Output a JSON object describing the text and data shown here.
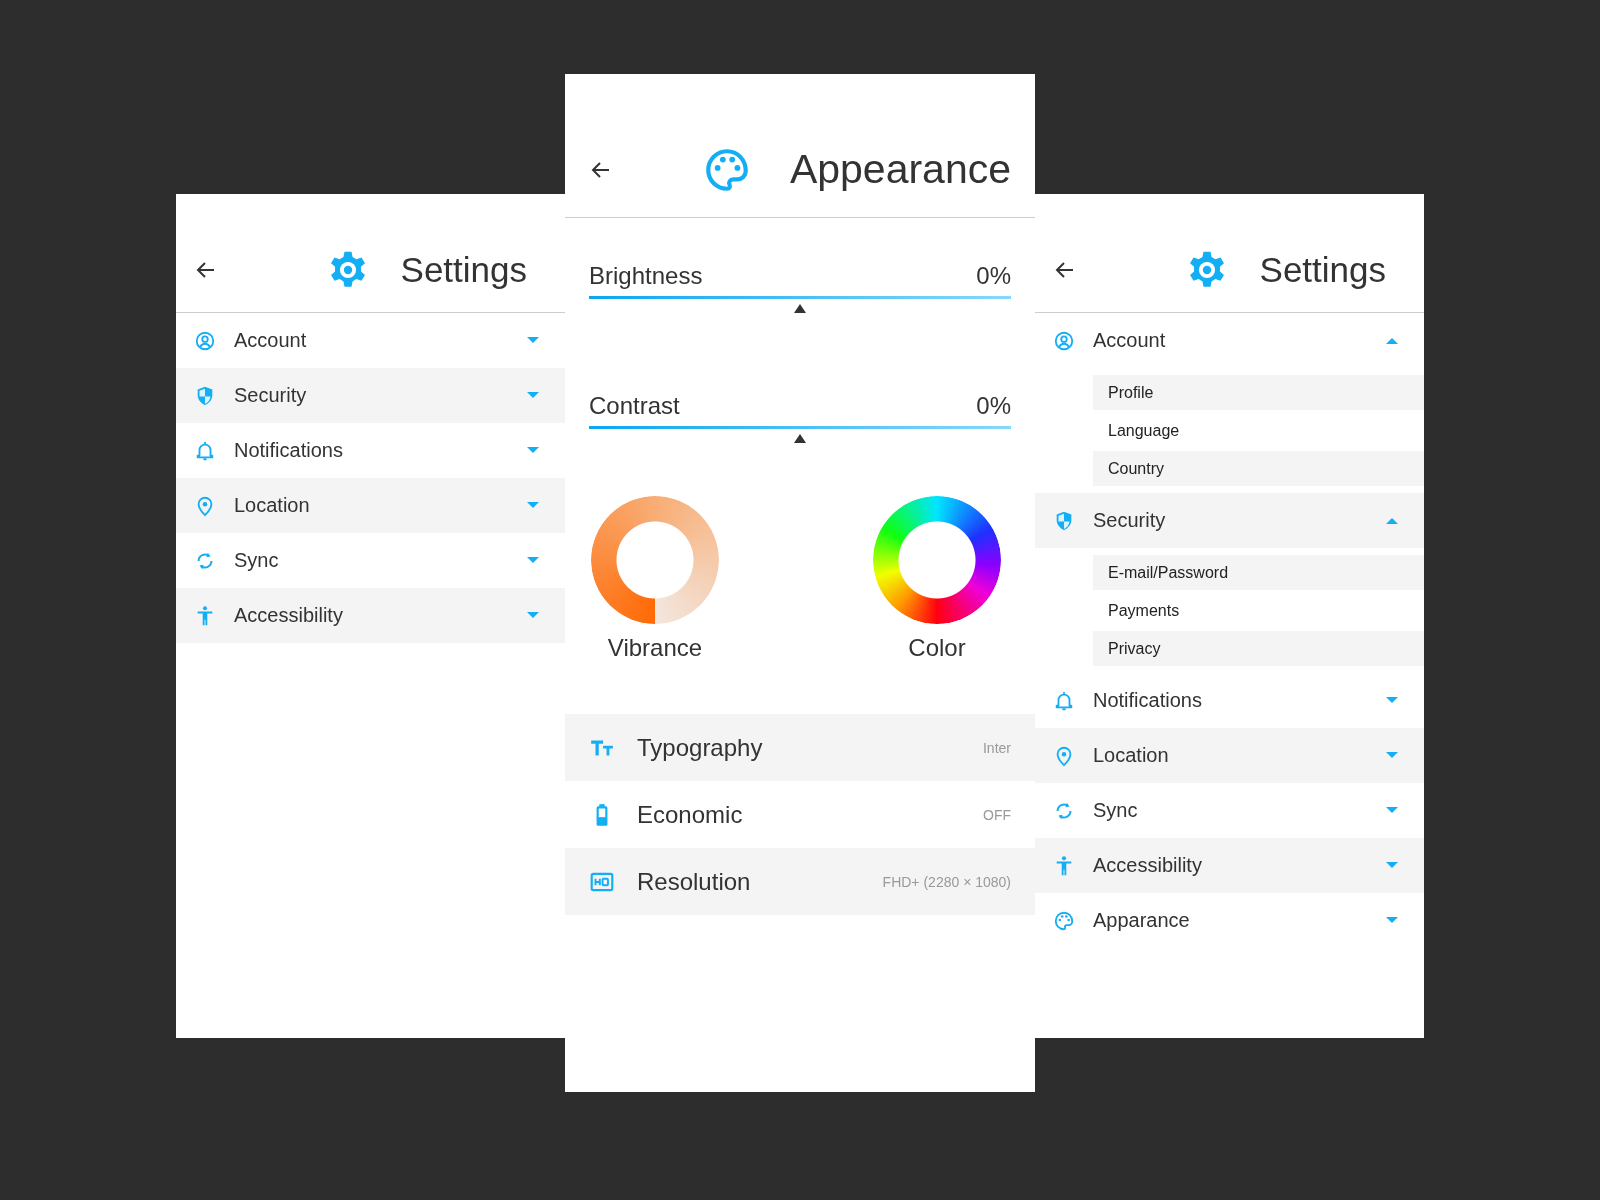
{
  "left_panel": {
    "title": "Settings",
    "items": [
      {
        "kind": "account",
        "label": "Account",
        "expanded": false
      },
      {
        "kind": "security",
        "label": "Security",
        "expanded": false
      },
      {
        "kind": "notifications",
        "label": "Notifications",
        "expanded": false
      },
      {
        "kind": "location",
        "label": "Location",
        "expanded": false
      },
      {
        "kind": "sync",
        "label": "Sync",
        "expanded": false
      },
      {
        "kind": "accessibility",
        "label": "Accessibility",
        "expanded": false
      }
    ]
  },
  "appearance_panel": {
    "title": "Appearance",
    "sliders": [
      {
        "label": "Brightness",
        "reading": "0%",
        "level": 0.5
      },
      {
        "label": "Contrast",
        "reading": "0%",
        "level": 0.5
      }
    ],
    "dials": [
      {
        "kind": "vibrance",
        "label": "Vibrance"
      },
      {
        "kind": "color",
        "label": "Color"
      }
    ],
    "options": [
      {
        "kind": "typography",
        "label": "Typography",
        "value": "Inter"
      },
      {
        "kind": "battery",
        "label": "Economic",
        "value": "OFF"
      },
      {
        "kind": "resolution",
        "label": "Resolution",
        "value": "FHD+ (2280 × 1080)"
      }
    ]
  },
  "right_panel": {
    "title": "Settings",
    "items": [
      {
        "kind": "account",
        "label": "Account",
        "expanded": true,
        "children": [
          {
            "label": "Profile"
          },
          {
            "label": "Language"
          },
          {
            "label": "Country"
          }
        ]
      },
      {
        "kind": "security",
        "label": "Security",
        "expanded": true,
        "children": [
          {
            "label": "E-mail/Password"
          },
          {
            "label": "Payments"
          },
          {
            "label": "Privacy"
          }
        ]
      },
      {
        "kind": "notifications",
        "label": "Notifications",
        "expanded": false
      },
      {
        "kind": "location",
        "label": "Location",
        "expanded": false
      },
      {
        "kind": "sync",
        "label": "Sync",
        "expanded": false
      },
      {
        "kind": "accessibility",
        "label": "Accessibility",
        "expanded": false
      },
      {
        "kind": "appearance",
        "label": "Apparance",
        "expanded": false
      }
    ]
  }
}
